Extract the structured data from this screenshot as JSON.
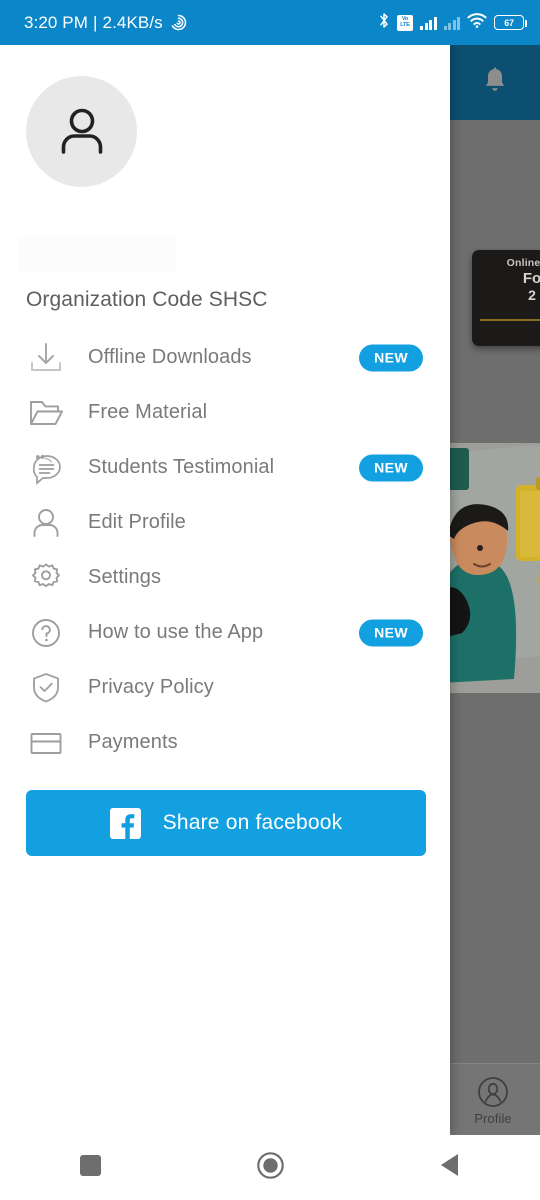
{
  "status_bar": {
    "time": "3:20 PM",
    "separator": "|",
    "network_speed": "2.4KB/s",
    "speed_icon": "data-saver-icon",
    "bluetooth_icon": "bluetooth-icon",
    "volte_line1": "Vo",
    "volte_line2": "LTE",
    "signal1_icon": "signal-bars-icon",
    "signal2_icon": "signal-bars-dim-icon",
    "wifi_icon": "wifi-icon",
    "battery_level": "67",
    "background_color": "#0b86c8"
  },
  "drawer": {
    "avatar_icon": "person-avatar-icon",
    "name_placeholder": "",
    "org_code": "Organization Code SHSC",
    "menu_items": [
      {
        "label": "Offline Downloads",
        "icon": "download-icon",
        "badge": "NEW"
      },
      {
        "label": "Free Material",
        "icon": "folder-icon",
        "badge": ""
      },
      {
        "label": "Students Testimonial",
        "icon": "testimonial-icon",
        "badge": "NEW"
      },
      {
        "label": "Edit Profile",
        "icon": "person-icon",
        "badge": ""
      },
      {
        "label": "Settings",
        "icon": "gear-icon",
        "badge": ""
      },
      {
        "label": "How to use the App",
        "icon": "question-mark-icon",
        "badge": "NEW"
      },
      {
        "label": "Privacy Policy",
        "icon": "shield-check-icon",
        "badge": ""
      },
      {
        "label": "Payments",
        "icon": "credit-card-icon",
        "badge": ""
      }
    ],
    "share_button": {
      "label": "Share on facebook",
      "icon": "facebook-icon",
      "color": "#12a0e0"
    },
    "badge_color": "#12a0e0",
    "background_color": "#ffffff"
  },
  "background_app": {
    "appbar_color": "#0d4f70",
    "notification_icon": "bell-icon",
    "promo_card": {
      "line1": "Online Re",
      "line2": "Fo",
      "line3": "2"
    },
    "illustration": "student-with-clipboard-illustration",
    "bottom_tab": {
      "label": "Profile",
      "icon": "profile-circle-icon"
    },
    "scrim_color": "#6e6e6e"
  },
  "android_nav": {
    "recents_icon": "square-recents-icon",
    "home_icon": "circle-home-icon",
    "back_icon": "triangle-back-icon",
    "color": "#ffffff"
  }
}
